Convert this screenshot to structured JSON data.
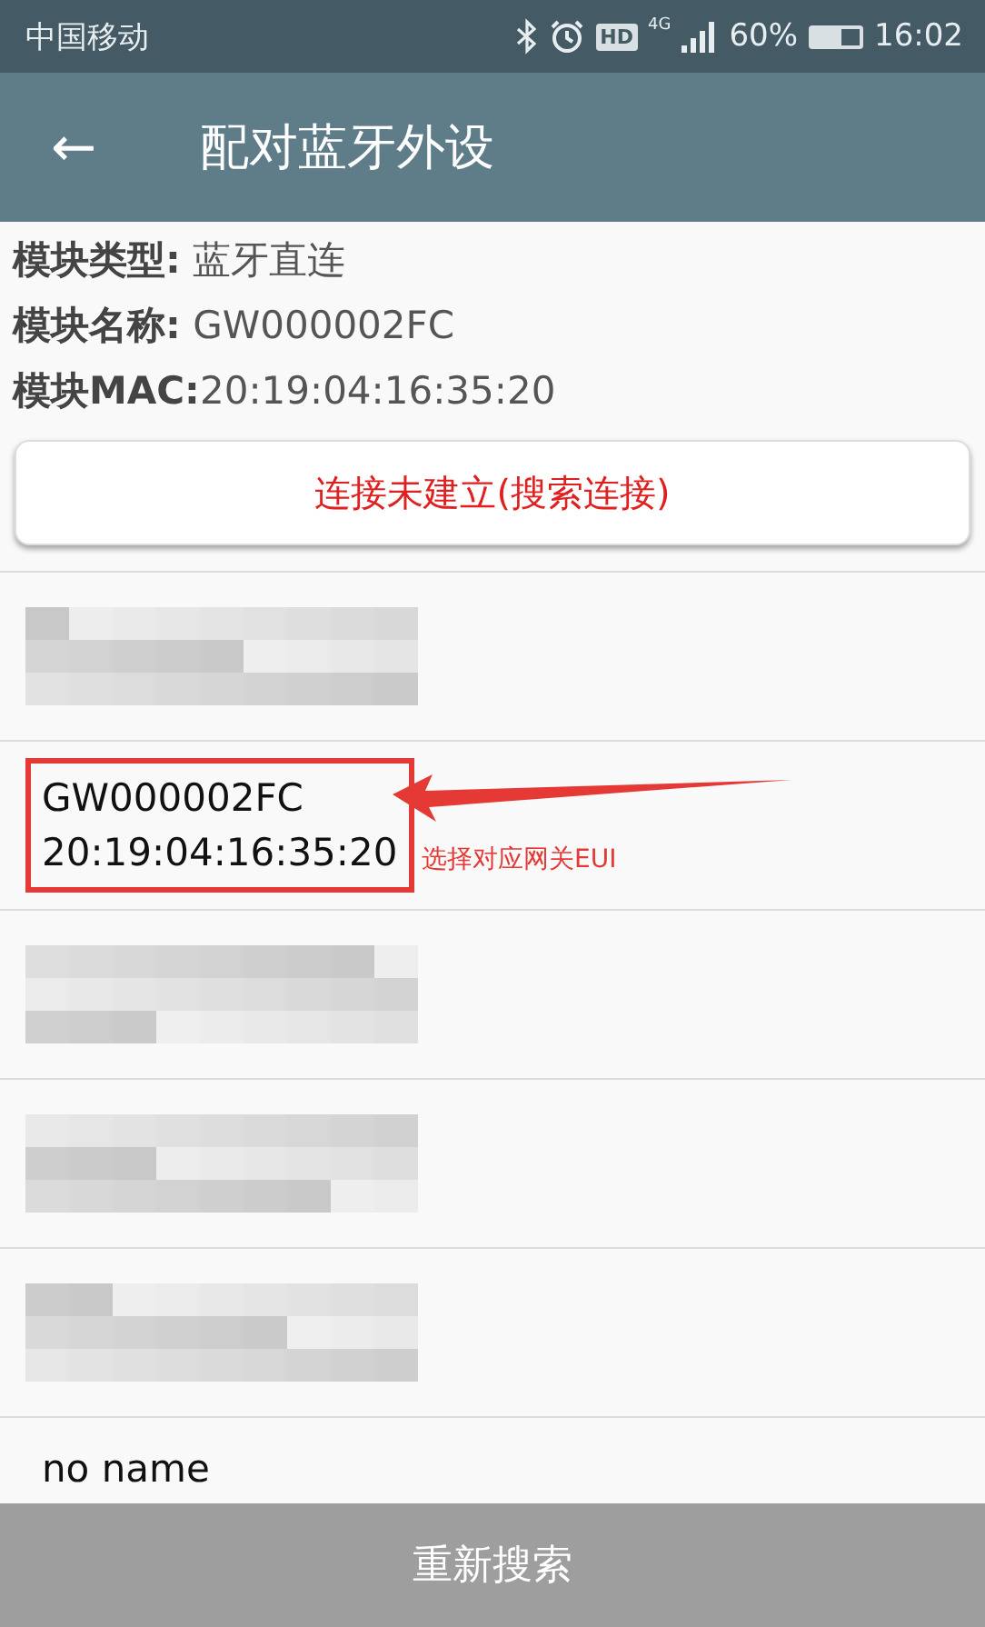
{
  "status_bar": {
    "carrier": "中国移动",
    "hd": "HD",
    "network": "4G",
    "battery": {
      "text": "60%",
      "level": 0.6
    },
    "time": "16:02"
  },
  "app_bar": {
    "back": "←",
    "title": "配对蓝牙外设"
  },
  "info": [
    {
      "label": "模块类型:",
      "value": " 蓝牙直连"
    },
    {
      "label": "模块名称:",
      "value": " GW000002FC"
    },
    {
      "label": "模块MAC:",
      "value": "20:19:04:16:35:20"
    }
  ],
  "connect_button": "连接未建立(搜索连接)",
  "devices": [
    {
      "kind": "redacted"
    },
    {
      "kind": "device",
      "name": "GW000002FC",
      "mac": "20:19:04:16:35:20",
      "annotated": true
    },
    {
      "kind": "redacted"
    },
    {
      "kind": "redacted"
    },
    {
      "kind": "redacted"
    },
    {
      "kind": "device",
      "name": "no name",
      "annotated": false
    }
  ],
  "annotation": "选择对应网关EUI",
  "bottom_button": "重新搜索"
}
